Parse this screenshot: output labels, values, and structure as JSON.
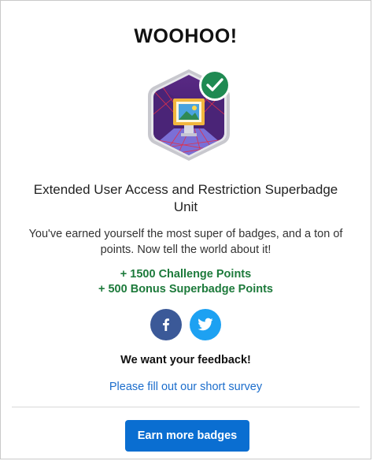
{
  "dialog": {
    "title": "WOOHOO!",
    "unit_title": "Extended User Access and Restriction Superbadge Unit",
    "message": "You've earned yourself the most super of badges, and a ton of points. Now tell the world about it!",
    "points": [
      "+ 1500 Challenge Points",
      "+ 500 Bonus Superbadge Points"
    ],
    "social": [
      {
        "icon": "facebook-icon",
        "color": "#3b5998"
      },
      {
        "icon": "twitter-icon",
        "color": "#1da1f2"
      }
    ],
    "feedback_heading": "We want your feedback!",
    "survey_link": "Please fill out our short survey",
    "cta_button": "Earn more badges"
  },
  "colors": {
    "accent_blue": "#0a6ed1",
    "points_green": "#1d7a3b",
    "check_green": "#1f8a52",
    "link_blue": "#1b6dcc"
  },
  "badge": {
    "icon": "superbadge-badge-icon",
    "status": "checkmark-icon"
  }
}
